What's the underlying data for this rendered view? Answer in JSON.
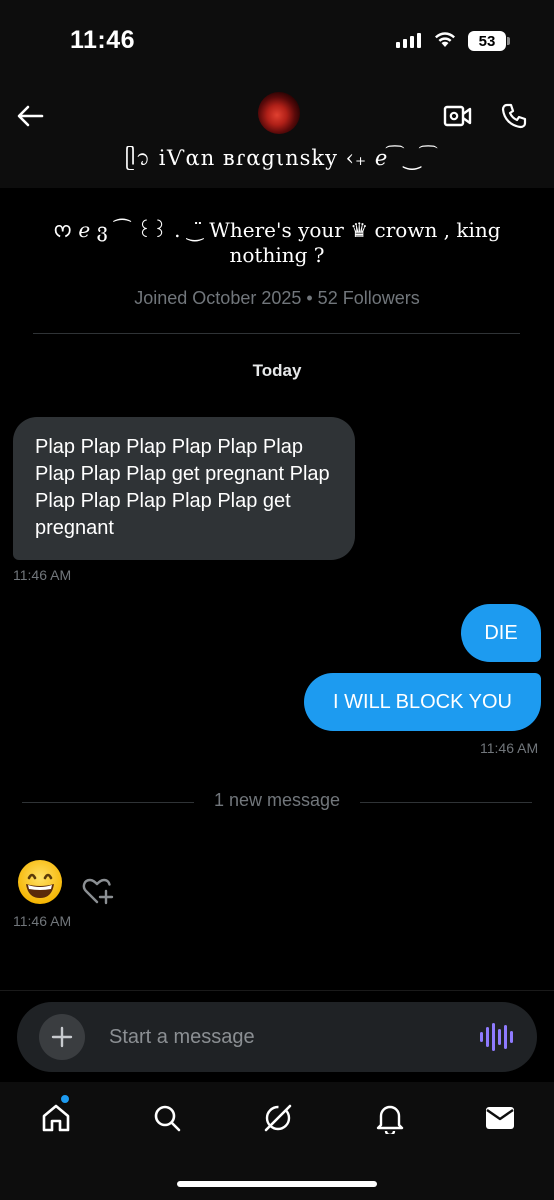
{
  "status_bar": {
    "time": "11:46",
    "battery": "53"
  },
  "header": {
    "display_name": "ᥫ᭡ iѴαn ʙɾαgιnsky ‹₊ ℯ ͡ ‿ ͡",
    "icons": {
      "back": "back-arrow-icon",
      "video": "video-call-icon",
      "call": "phone-icon"
    }
  },
  "profile": {
    "bio": "ᰔ ℯ ვ ⁀ ꒰꒱ . ‿̈ Where's your ♛ crown , king nothing ?",
    "joined": "Joined October 2025 • 52 Followers"
  },
  "conversation": {
    "day_label": "Today",
    "messages": [
      {
        "direction": "in",
        "text": "Plap Plap Plap Plap Plap Plap Plap Plap Plap get pregnant Plap Plap Plap Plap Plap Plap get pregnant",
        "time": "11:46 AM"
      },
      {
        "direction": "out",
        "text": "DIE"
      },
      {
        "direction": "out",
        "text": "I WILL BLOCK YOU",
        "time": "11:46 AM"
      }
    ],
    "new_message_divider": "1 new message",
    "emoji_message": {
      "emoji": "😁",
      "time": "11:46 AM"
    }
  },
  "composer": {
    "placeholder": "Start a message",
    "accent_color": "#8f7bff"
  },
  "tabbar": {
    "tabs": [
      {
        "name": "home",
        "icon": "home-icon",
        "has_notification": true
      },
      {
        "name": "search",
        "icon": "search-icon"
      },
      {
        "name": "grok",
        "icon": "grok-icon"
      },
      {
        "name": "notifications",
        "icon": "bell-icon"
      },
      {
        "name": "messages",
        "icon": "envelope-icon"
      }
    ]
  },
  "colors": {
    "accent": "#1d9bf0",
    "incoming_bubble": "#2f3336",
    "muted_text": "#71767b"
  }
}
